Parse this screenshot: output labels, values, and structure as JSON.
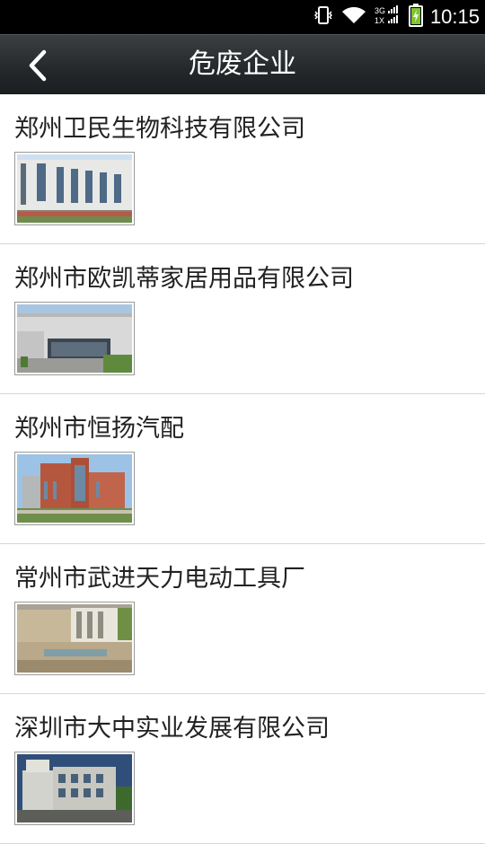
{
  "status_bar": {
    "time": "10:15",
    "icons": [
      "vibrate-icon",
      "wifi-icon",
      "signal-3g-1x-icon",
      "battery-charging-icon"
    ]
  },
  "nav": {
    "title": "危废企业",
    "back_icon": "chevron-left-icon"
  },
  "companies": [
    {
      "name": "郑州卫民生物科技有限公司",
      "image": "factory-photo-1"
    },
    {
      "name": "郑州市欧凯蒂家居用品有限公司",
      "image": "factory-photo-2"
    },
    {
      "name": "郑州市恒扬汽配",
      "image": "factory-photo-3"
    },
    {
      "name": "常州市武进天力电动工具厂",
      "image": "factory-photo-4"
    },
    {
      "name": "深圳市大中实业发展有限公司",
      "image": "factory-photo-5"
    }
  ]
}
